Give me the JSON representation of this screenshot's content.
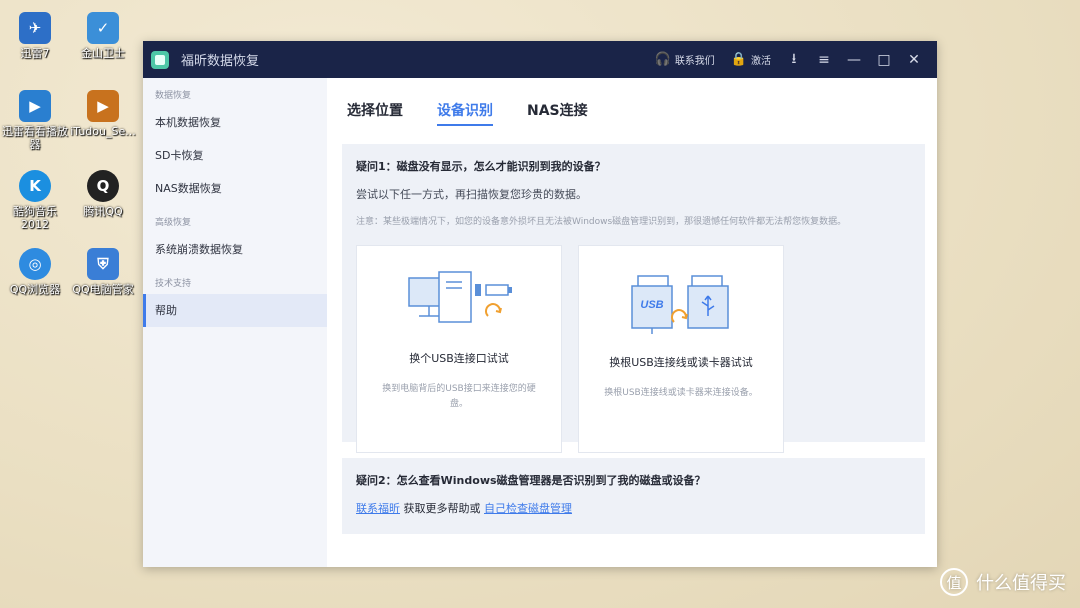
{
  "desktop": {
    "icons": [
      {
        "label": "迅雷7",
        "glyph": "✈",
        "color": "#2d6fc7"
      },
      {
        "label": "金山卫士",
        "glyph": "✓",
        "color": "#3b8fd8"
      },
      {
        "label": "迅雷看看播放器",
        "glyph": "▶",
        "color": "#2a7fd0"
      },
      {
        "label": "iTudou_Se...",
        "glyph": "▶",
        "color": "#c8721e"
      },
      {
        "label": "酷狗音乐2012",
        "glyph": "K",
        "color": "#1b8fe0"
      },
      {
        "label": "腾讯QQ",
        "glyph": "Q",
        "color": "#222222"
      },
      {
        "label": "QQ浏览器",
        "glyph": "◎",
        "color": "#2e8be0"
      },
      {
        "label": "QQ电脑管家",
        "glyph": "⛨",
        "color": "#3a7ed6"
      }
    ]
  },
  "window": {
    "title": "福昕数据恢复",
    "contact_label": "联系我们",
    "activate_label": "激活",
    "controls": {
      "download": "⭳",
      "menu": "≡",
      "minimize": "—",
      "maximize": "□",
      "close": "✕"
    }
  },
  "sidebar": {
    "section1": "数据恢复",
    "item_local": "本机数据恢复",
    "item_sd": "SD卡恢复",
    "item_nas": "NAS数据恢复",
    "section2": "高级恢复",
    "item_crash": "系统崩溃数据恢复",
    "section3": "技术支持",
    "item_help": "帮助"
  },
  "tabs": {
    "location": "选择位置",
    "device": "设备识别",
    "nas": "NAS连接"
  },
  "faq1": {
    "title": "疑问1：磁盘没有显示，怎么才能识别到我的设备？",
    "subtitle": "尝试以下任一方式，再扫描恢复您珍贵的数据。",
    "note": "注意：某些极端情况下，如您的设备意外损坏且无法被Windows磁盘管理识别到，那很遗憾任何软件都无法帮您恢复数据。",
    "card1_title": "换个USB连接口试试",
    "card1_desc": "换到电脑背后的USB接口来连接您的硬盘。",
    "card2_title": "换根USB连接线或读卡器试试",
    "card2_desc": "换根USB连接线或读卡器来连接设备。",
    "usb_text": "USB"
  },
  "faq2": {
    "title": "疑问2：怎么查看Windows磁盘管理器是否识别到了我的磁盘或设备？",
    "link1": "联系福昕",
    "middle_text": "获取更多帮助或",
    "link2": "自己检查磁盘管理"
  },
  "watermark": {
    "glyph": "值",
    "text": "什么值得买"
  },
  "colors": {
    "titlebar": "#1a2448",
    "accent": "#3f7bea",
    "icon_stroke": "#5a8fd8",
    "icon_orange": "#f0a030"
  }
}
